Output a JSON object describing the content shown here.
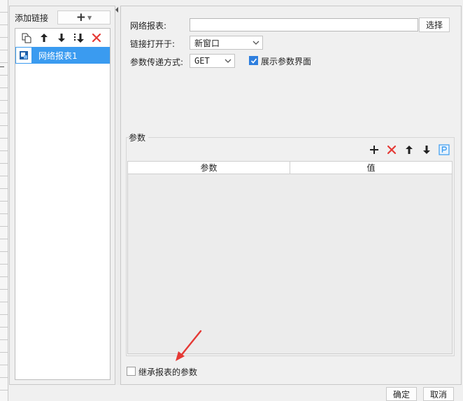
{
  "left": {
    "add_link_label": "添加链接",
    "list_items": [
      {
        "label": "网络报表1",
        "selected": true
      }
    ]
  },
  "right": {
    "report_label": "网络报表:",
    "report_value": "",
    "choose_button": "选择",
    "open_in_label": "链接打开于:",
    "open_in_value": "新窗口",
    "method_label": "参数传递方式:",
    "method_value": "GET",
    "show_params_label": "展示参数界面",
    "show_params_checked": true,
    "params_group_title": "参数",
    "params_columns": [
      "参数",
      "值"
    ],
    "params_rows": [],
    "inherit_label": "继承报表的参数",
    "inherit_checked": false
  },
  "footer": {
    "ok_button": "确定",
    "cancel_button": "取消"
  },
  "colors": {
    "accent": "#3a9bf0",
    "delete_red": "#e53935",
    "annotation_arrow": "#e53935"
  }
}
